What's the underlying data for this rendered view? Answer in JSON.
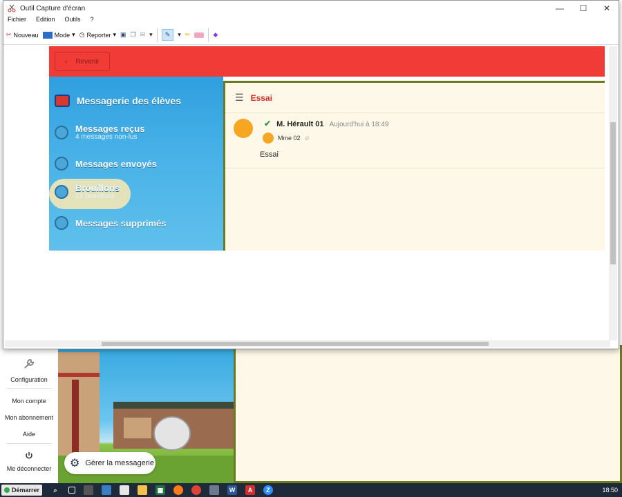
{
  "window": {
    "title": "Outil Capture d'écran",
    "controls": {
      "minimize": "—",
      "maximize": "☐",
      "close": "✕"
    }
  },
  "menu": [
    "Fichier",
    "Edition",
    "Outils",
    "?"
  ],
  "toolbar": {
    "new_label": "Nouveau",
    "mode_label": "Mode",
    "delay_label": "Reporter"
  },
  "captured": {
    "back_label": "Revenir",
    "section_title": "Messagerie des élèves",
    "nav": [
      {
        "title": "Messages reçus",
        "subtitle": "4 messages non-lus"
      },
      {
        "title": "Messages envoyés",
        "subtitle": ""
      },
      {
        "title": "Brouillons",
        "subtitle": "12 brouillons"
      },
      {
        "title": "Messages supprimés",
        "subtitle": ""
      }
    ],
    "thread_title": "Essai",
    "message": {
      "sender": "M. Hérault 01",
      "date": "Aujourd'hui à 18:49",
      "recipient": "Mme 02",
      "body": "Essai"
    }
  },
  "background": {
    "sidebar": [
      "Configuration",
      "Mon compte",
      "Mon abonnement",
      "Aide",
      "Me déconnecter"
    ],
    "manage_label": "Gérer la messagerie"
  },
  "taskbar": {
    "start_label": "Démarrer",
    "clock": "18:50",
    "app_icons": [
      {
        "name": "word",
        "glyph": "W",
        "color": "#2b579a"
      },
      {
        "name": "acrobat",
        "glyph": "A",
        "color": "#d32f2f"
      },
      {
        "name": "zoom",
        "glyph": "Z",
        "color": "#2d8cff"
      }
    ]
  },
  "colors": {
    "header_red": "#f03b36",
    "sky_blue": "#2f9fdf",
    "cream": "#fdf8e8",
    "olive_border": "#6b7a1f",
    "title_red": "#d02a24"
  }
}
